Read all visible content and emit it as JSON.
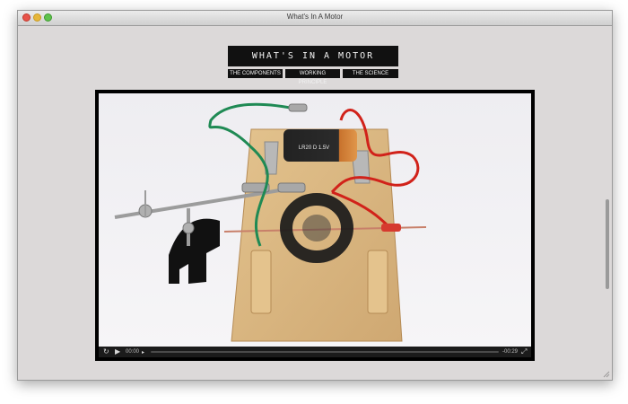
{
  "window": {
    "title": "What's In A Motor"
  },
  "header": {
    "logo_text": "WHAT'S IN A MOTOR"
  },
  "nav": {
    "items": [
      {
        "label": "THE COMPONENTS"
      },
      {
        "label": "WORKING PRINCIPLE"
      },
      {
        "label": "THE SCIENCE"
      }
    ]
  },
  "video": {
    "battery_label": "LR20 D 1.5V",
    "current_time": "00:00",
    "remaining_time": "-00:29",
    "progress": 0.0,
    "icons": {
      "replay": "replay-icon",
      "play": "play-icon",
      "volume": "volume-icon",
      "fullscreen": "fullscreen-icon"
    }
  },
  "colors": {
    "window_bg": "#dcd9d9",
    "nav_bg": "#111111",
    "wire_green": "#1f8a54",
    "wire_red": "#d1221a",
    "wood": "#d9b57e"
  }
}
